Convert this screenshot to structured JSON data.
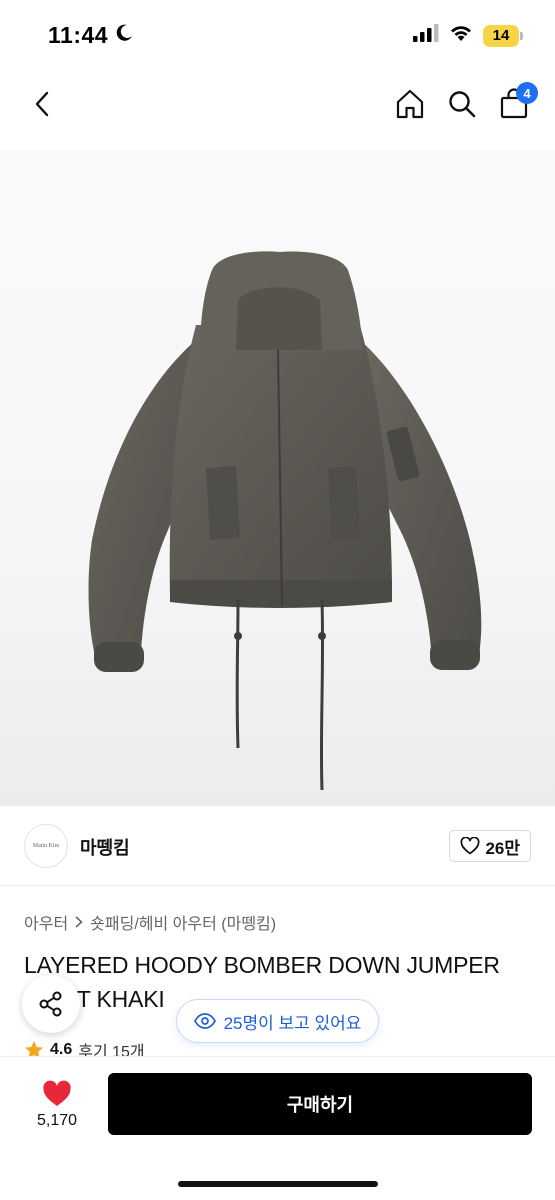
{
  "status_bar": {
    "time": "11:44",
    "battery": "14",
    "icons": [
      "moon-icon",
      "signal-icon",
      "wifi-icon",
      "battery-icon"
    ]
  },
  "nav": {
    "icons": [
      "back-icon",
      "home-icon",
      "search-icon",
      "cart-icon"
    ],
    "cart_count": "4",
    "accent_color": "#1e6ff1"
  },
  "brand": {
    "logo_text": "Matin Kim",
    "name": "마뗑킴",
    "like_count": "26만"
  },
  "breadcrumb": {
    "category": "아우터",
    "subcategory": "숏패딩/헤비 아우터 (마뗑킴)"
  },
  "product": {
    "title": "LAYERED HOODY BOMBER DOWN JUMPER LIGHT KHAKI",
    "rating": "4.6",
    "reviews": "후기 15개"
  },
  "viewers": {
    "text": "25명이 보고 있어요"
  },
  "bottom": {
    "wish_count": "5,170",
    "buy_label": "구매하기"
  },
  "colors": {
    "heart": "#e8283a",
    "buy_button": "#000000",
    "star": "#f5a623"
  }
}
